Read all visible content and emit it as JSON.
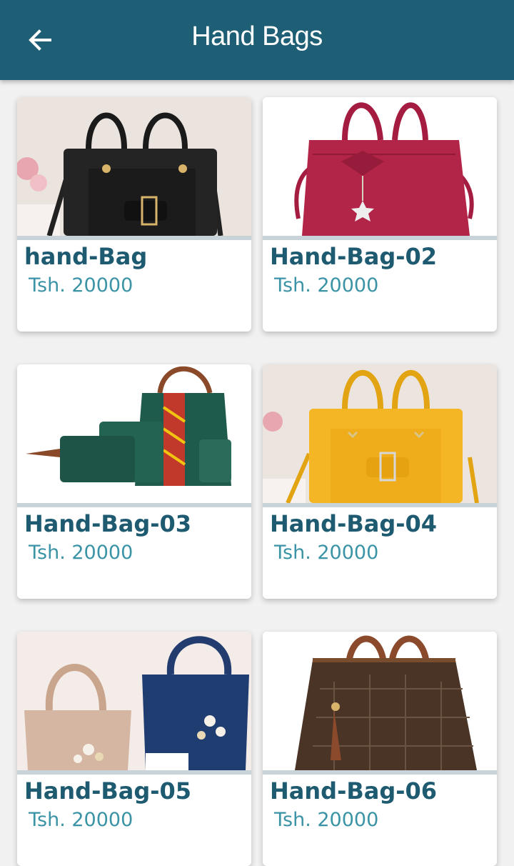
{
  "appbar": {
    "title": "Hand Bags",
    "back_icon": "arrow-left-icon",
    "background": "#1e5f76"
  },
  "products": [
    {
      "name": "hand-Bag",
      "price": "Tsh. 20000",
      "bag_color": "#222222",
      "bg_color": "#e9e2dd"
    },
    {
      "name": "Hand-Bag-02",
      "price": "Tsh. 20000",
      "bag_color": "#b0224a",
      "bg_color": "#ffffff"
    },
    {
      "name": "Hand-Bag-03",
      "price": "Tsh. 20000",
      "bag_color": "#1f5a4c",
      "bg_color": "#ffffff"
    },
    {
      "name": "Hand-Bag-04",
      "price": "Tsh. 20000",
      "bag_color": "#f2b21f",
      "bg_color": "#ece4df"
    },
    {
      "name": "Hand-Bag-05",
      "price": "Tsh. 20000",
      "bag_color": "#1e3a6e",
      "bg_color": "#f3ece8"
    },
    {
      "name": "Hand-Bag-06",
      "price": "Tsh. 20000",
      "bag_color": "#4a3426",
      "bg_color": "#ffffff"
    }
  ]
}
